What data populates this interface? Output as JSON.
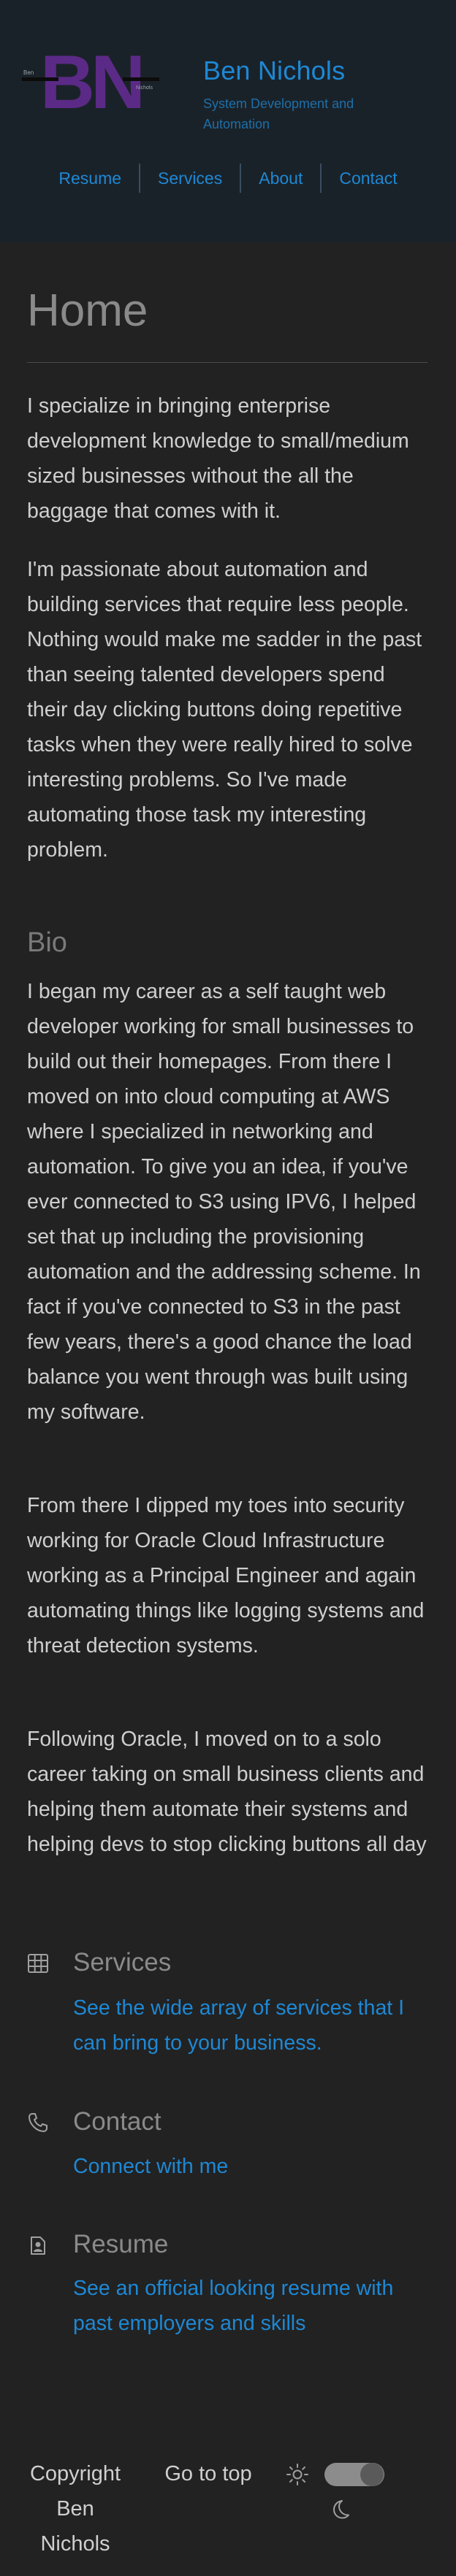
{
  "header": {
    "logo_text": "BN",
    "logo_left_tag": "Ben",
    "logo_right_tag": "Nichols",
    "title": "Ben Nichols",
    "tagline": "System Development and Automation",
    "nav": [
      "Resume",
      "Services",
      "About",
      "Contact"
    ]
  },
  "main": {
    "title": "Home",
    "intro": [
      "I specialize in bringing enterprise development knowledge to small/medium sized businesses without the all the baggage that comes with it.",
      "I'm passionate about automation and building services that require less people. Nothing would make me sadder in the past than seeing talented developers spend their day clicking buttons doing repetitive tasks when they were really hired to solve interesting problems. So I've made automating those task my interesting problem."
    ],
    "bio_heading": "Bio",
    "bio": [
      "I began my career as a self taught web developer working for small businesses to build out their homepages. From there I moved on into cloud computing at AWS where I specialized in networking and automation. To give you an idea, if you've ever connected to S3 using IPV6, I helped set that up including the provisioning automation and the addressing scheme. In fact if you've connected to S3 in the past few years, there's a good chance the load balance you went through was built using my software.",
      "From there I dipped my toes into security working for Oracle Cloud Infrastructure working as a Principal Engineer and again automating things like logging systems and threat detection systems.",
      "Following Oracle, I moved on to a solo career taking on small business clients and helping them automate their systems and helping devs to stop clicking buttons all day"
    ]
  },
  "cards": [
    {
      "icon": "services-grid-icon",
      "title": "Services",
      "link": "See the wide array of services that I can bring to your business."
    },
    {
      "icon": "phone-icon",
      "title": "Contact",
      "link": "Connect with me"
    },
    {
      "icon": "resume-badge-icon",
      "title": "Resume",
      "link": "See an official looking resume with past employers and skills"
    }
  ],
  "footer": {
    "copyright": "Copyright Ben Nichols",
    "go_to_top": "Go to top",
    "theme_toggle_state": "dark"
  },
  "colors": {
    "background": "#222222",
    "header_background": "#1a2229",
    "accent": "#1e88d4",
    "logo_purple": "#5b2a86",
    "muted_heading": "#8a8a8a"
  }
}
